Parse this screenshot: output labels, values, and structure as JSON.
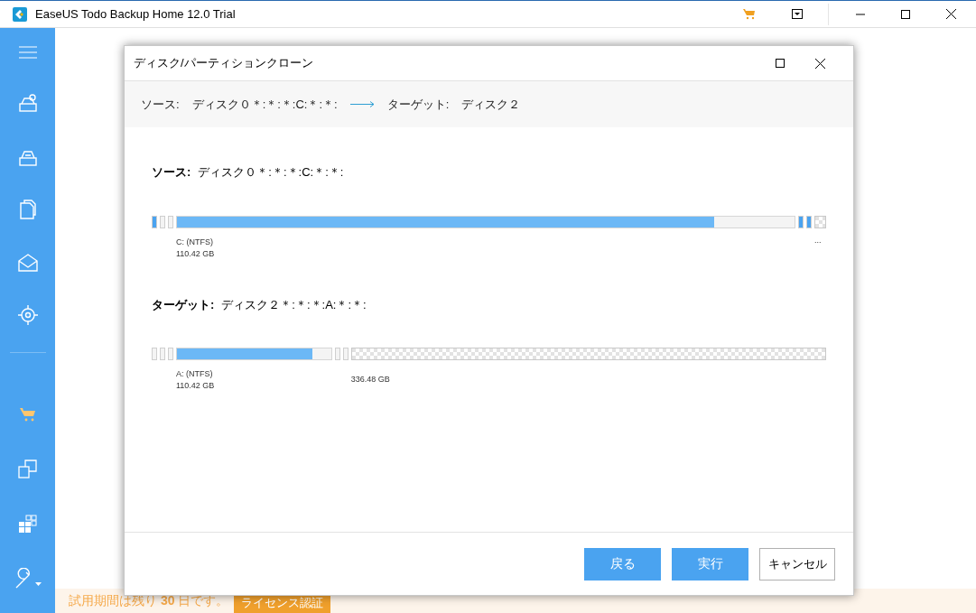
{
  "window": {
    "title": "EaseUS Todo Backup Home 12.0 Trial"
  },
  "dialog": {
    "title": "ディスク/パーティションクローン",
    "summary": {
      "source_label": "ソース:",
      "source_value": "ディスク０＊:＊:＊:C:＊:＊:",
      "target_label": "ターゲット:",
      "target_value": "ディスク２"
    },
    "source": {
      "label": "ソース:",
      "value": "ディスク０＊:＊:＊:C:＊:＊:",
      "segments": [
        {
          "kind": "small",
          "used": true
        },
        {
          "kind": "small",
          "used": false
        },
        {
          "kind": "small",
          "used": false
        },
        {
          "kind": "partition",
          "level": 0.87,
          "name": "C: (NTFS)",
          "size": "110.42 GB"
        },
        {
          "kind": "small",
          "used": true
        },
        {
          "kind": "small",
          "used": true
        },
        {
          "kind": "unallocated",
          "size": "..."
        }
      ]
    },
    "target": {
      "label": "ターゲット:",
      "value": "ディスク２＊:＊:＊:A:＊:＊:",
      "segments": [
        {
          "kind": "small",
          "used": false
        },
        {
          "kind": "small",
          "used": false
        },
        {
          "kind": "small",
          "used": false
        },
        {
          "kind": "partition",
          "level": 0.88,
          "name": "A: (NTFS)",
          "size": "110.42 GB"
        },
        {
          "kind": "small",
          "used": false
        },
        {
          "kind": "small",
          "used": false
        },
        {
          "kind": "unallocated",
          "size": "336.48 GB"
        }
      ]
    },
    "buttons": [
      {
        "label": "戻る",
        "kind": "primary"
      },
      {
        "label": "実行",
        "kind": "primary"
      },
      {
        "label": "キャンセル",
        "kind": "secondary"
      }
    ]
  },
  "trial": {
    "message": "試用期間は残り **30** 日です。",
    "button": "ライセンス認証"
  }
}
